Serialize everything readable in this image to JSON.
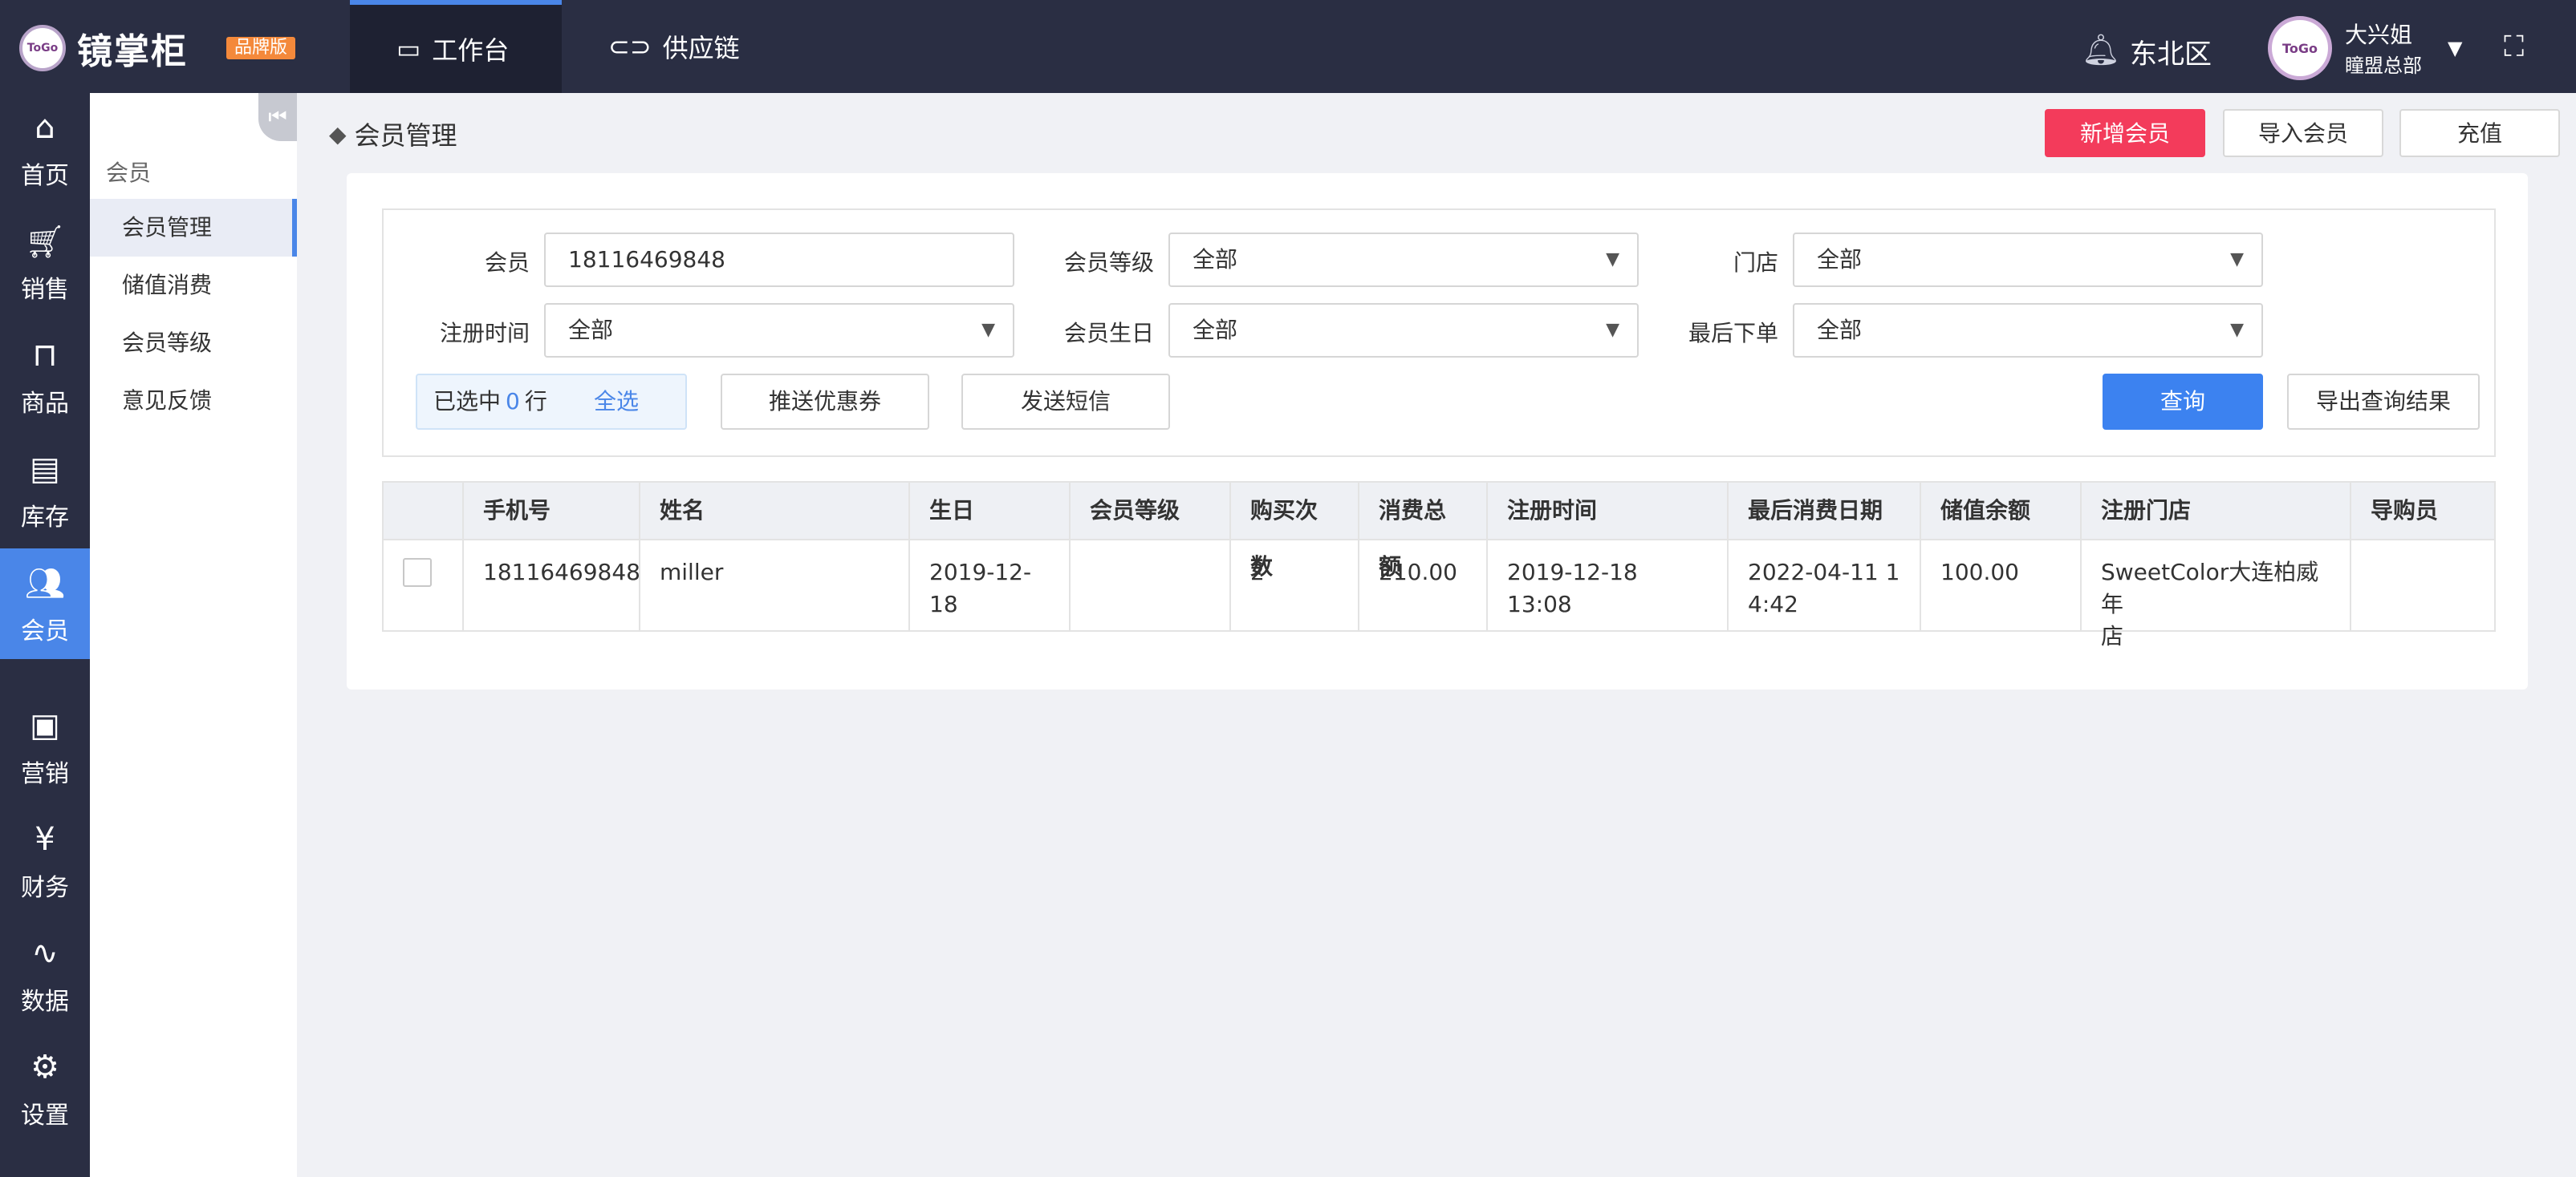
{
  "app": {
    "name": "镜掌柜",
    "badge": "品牌版",
    "logo_text": "ToGo"
  },
  "top_tabs": [
    {
      "label": "工作台",
      "icon": "monitor-icon",
      "active": true
    },
    {
      "label": "供应链",
      "icon": "link-icon",
      "active": false
    }
  ],
  "header": {
    "region": "东北区",
    "user_name": "大兴姐",
    "user_org": "瞳盟总部",
    "avatar_text": "ToGo"
  },
  "left_nav": [
    {
      "label": "首页",
      "icon": "home-icon"
    },
    {
      "label": "销售",
      "icon": "cart-icon"
    },
    {
      "label": "商品",
      "icon": "bag-icon"
    },
    {
      "label": "库存",
      "icon": "inventory-icon"
    },
    {
      "label": "会员",
      "icon": "members-icon",
      "active": true
    },
    {
      "label": "营销",
      "icon": "marketing-icon"
    },
    {
      "label": "财务",
      "icon": "yen-icon"
    },
    {
      "label": "数据",
      "icon": "pulse-icon"
    },
    {
      "label": "设置",
      "icon": "gear-icon"
    }
  ],
  "sub_nav": {
    "group": "会员",
    "items": [
      {
        "label": "会员管理",
        "active": true
      },
      {
        "label": "储值消费"
      },
      {
        "label": "会员等级"
      },
      {
        "label": "意见反馈"
      }
    ]
  },
  "page": {
    "title": "会员管理",
    "buttons": {
      "add": "新增会员",
      "import": "导入会员",
      "recharge": "充值"
    }
  },
  "filters": {
    "member_label": "会员",
    "member_value": "18116469848",
    "level_label": "会员等级",
    "level_value": "全部",
    "store_label": "门店",
    "store_value": "全部",
    "reg_label": "注册时间",
    "reg_value": "全部",
    "birthday_label": "会员生日",
    "birthday_value": "全部",
    "last_order_label": "最后下单",
    "last_order_value": "全部"
  },
  "actions": {
    "selected_prefix": "已选中",
    "selected_count": "0",
    "selected_suffix": "行",
    "select_all": "全选",
    "push_coupon": "推送优惠券",
    "send_sms": "发送短信",
    "query": "查询",
    "export": "导出查询结果"
  },
  "table": {
    "headers": [
      "手机号",
      "姓名",
      "生日",
      "会员等级",
      "购买次数",
      "消费总额",
      "注册时间",
      "最后消费日期",
      "储值余额",
      "注册门店",
      "导购员"
    ],
    "rows": [
      {
        "phone": "18116469848",
        "name": "miller",
        "birthday": "2019-12-18",
        "level": "",
        "purchases": "2",
        "total": "210.00",
        "registered": "2019-12-18 13:08",
        "last_consume_1": "2022-04-11 1",
        "last_consume_2": "4:42",
        "balance": "100.00",
        "store_1": "SweetColor大连柏威年",
        "store_2": "店",
        "guide": ""
      }
    ]
  }
}
